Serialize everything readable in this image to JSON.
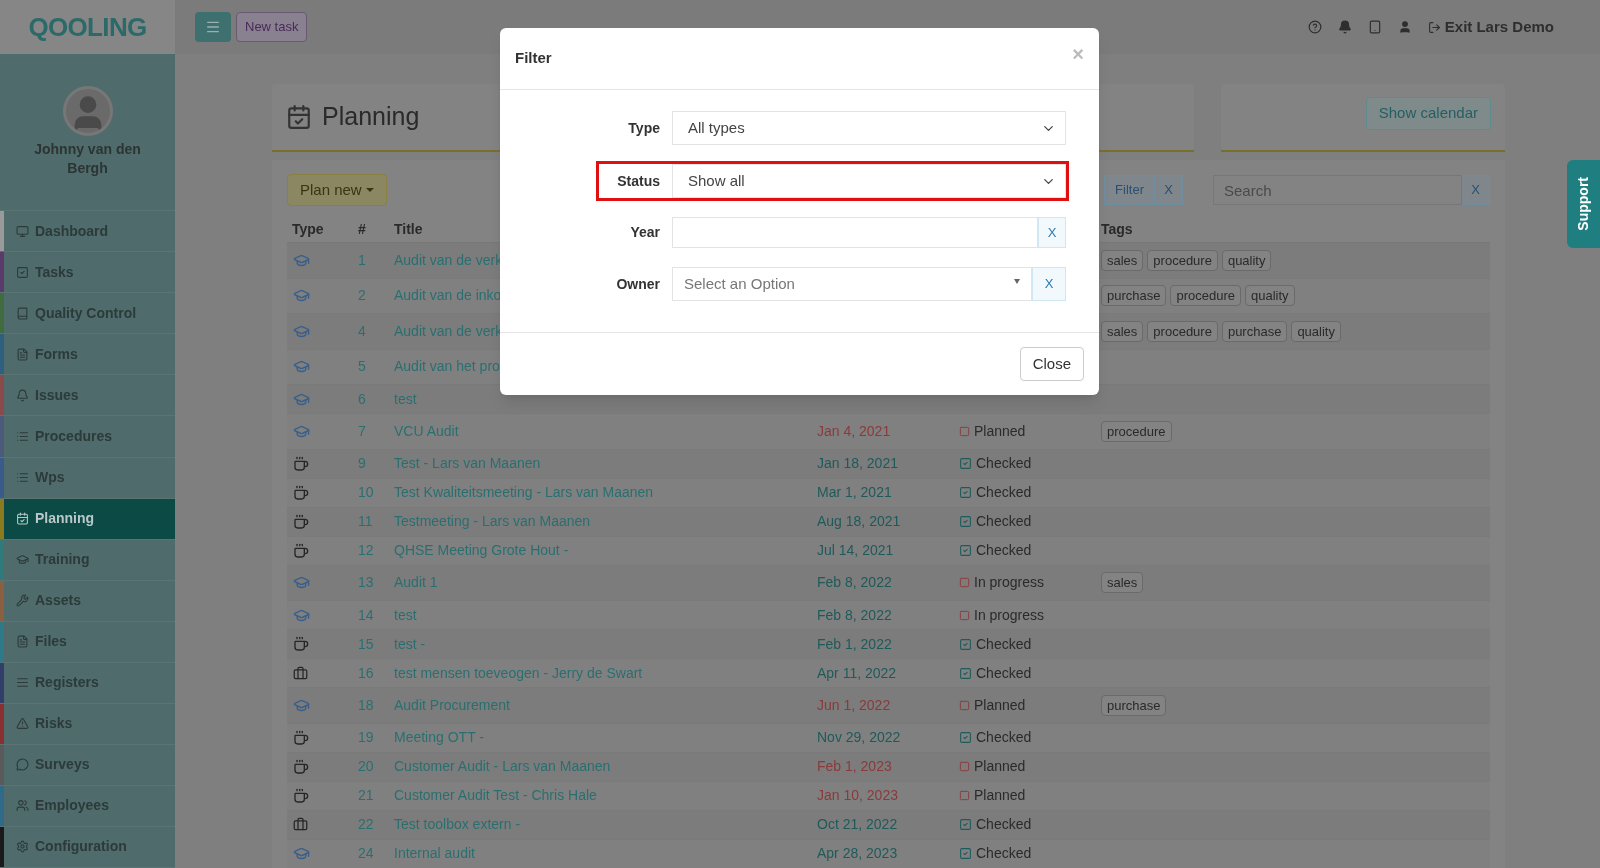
{
  "logo": "QOOLING",
  "header": {
    "new_task": "New task",
    "exit": "Exit Lars Demo"
  },
  "user": {
    "name": "Johnny van den Bergh"
  },
  "sidebar": {
    "items": [
      {
        "label": "Dashboard",
        "kind": "monitor",
        "color": "#9a9a9a",
        "selected": false
      },
      {
        "label": "Tasks",
        "kind": "check",
        "color": "#5a3a6a",
        "selected": false
      },
      {
        "label": "Quality Control",
        "kind": "book",
        "color": "#3f6b3f",
        "selected": false
      },
      {
        "label": "Forms",
        "kind": "file",
        "color": "#2f5f7f",
        "selected": false
      },
      {
        "label": "Issues",
        "kind": "bell",
        "color": "#8a4a4a",
        "selected": false
      },
      {
        "label": "Procedures",
        "kind": "list",
        "color": "#4a5a7a",
        "selected": false
      },
      {
        "label": "Wps",
        "kind": "list",
        "color": "#3a5a8a",
        "selected": false
      },
      {
        "label": "Planning",
        "kind": "calendar",
        "color": "#8a7a20",
        "selected": true
      },
      {
        "label": "Training",
        "kind": "cap",
        "color": "#2f7a7a",
        "selected": false
      },
      {
        "label": "Assets",
        "kind": "wrench",
        "color": "#8a6040",
        "selected": false
      },
      {
        "label": "Files",
        "kind": "file",
        "color": "#2f7a8a",
        "selected": false
      },
      {
        "label": "Registers",
        "kind": "lines",
        "color": "#2f3f6a",
        "selected": false
      },
      {
        "label": "Risks",
        "kind": "warning",
        "color": "#8a2f2f",
        "selected": false
      },
      {
        "label": "Surveys",
        "kind": "chat",
        "color": "#5a5a5a",
        "selected": false
      },
      {
        "label": "Employees",
        "kind": "users",
        "color": "#2f6a8a",
        "selected": false
      },
      {
        "label": "Configuration",
        "kind": "gear",
        "color": "#1a1a1a",
        "selected": false
      }
    ]
  },
  "page": {
    "title": "Planning",
    "show_calendar": "Show calendar",
    "plan_new": "Plan new",
    "filter": "Filter",
    "filter_clear": "X",
    "search": {
      "placeholder": "Search"
    },
    "search_clear": "X"
  },
  "table": {
    "columns": [
      "Type",
      "#",
      "Title",
      "Tags"
    ],
    "rows": [
      {
        "kind": "training",
        "number": "1",
        "title": "Audit van de verk",
        "tags": [
          "sales",
          "procedure",
          "quality"
        ]
      },
      {
        "kind": "training",
        "number": "2",
        "title": "Audit van de inko",
        "tags": [
          "purchase",
          "procedure",
          "quality"
        ]
      },
      {
        "kind": "training",
        "number": "4",
        "title": "Audit van de verk",
        "tags": [
          "sales",
          "procedure",
          "purchase",
          "quality"
        ]
      },
      {
        "kind": "training",
        "number": "5",
        "title": "Audit van het pro",
        "tags": []
      },
      {
        "kind": "training",
        "number": "6",
        "title": "test",
        "tags": []
      },
      {
        "kind": "training",
        "number": "7",
        "title": "VCU Audit",
        "date": "Jan 4, 2021",
        "overdue": true,
        "status": "Planned",
        "checked": false,
        "tags": [
          "procedure"
        ]
      },
      {
        "kind": "meeting",
        "number": "9",
        "title": "Test - Lars van Maanen",
        "date": "Jan 18, 2021",
        "overdue": false,
        "status": "Checked",
        "checked": true,
        "tags": []
      },
      {
        "kind": "meeting",
        "number": "10",
        "title": "Test Kwaliteitsmeeting - Lars van Maanen",
        "date": "Mar 1, 2021",
        "overdue": false,
        "status": "Checked",
        "checked": true,
        "tags": []
      },
      {
        "kind": "meeting",
        "number": "11",
        "title": "Testmeeting - Lars van Maanen",
        "date": "Aug 18, 2021",
        "overdue": false,
        "status": "Checked",
        "checked": true,
        "tags": []
      },
      {
        "kind": "meeting",
        "number": "12",
        "title": "QHSE Meeting Grote Hout -",
        "date": "Jul 14, 2021",
        "overdue": false,
        "status": "Checked",
        "checked": true,
        "tags": []
      },
      {
        "kind": "training",
        "number": "13",
        "title": "Audit 1",
        "date": "Feb 8, 2022",
        "overdue": false,
        "status": "In progress",
        "checked": false,
        "tags": [
          "sales"
        ]
      },
      {
        "kind": "training",
        "number": "14",
        "title": "test",
        "date": "Feb 8, 2022",
        "overdue": false,
        "status": "In progress",
        "checked": false,
        "tags": []
      },
      {
        "kind": "meeting",
        "number": "15",
        "title": "test -",
        "date": "Feb 1, 2022",
        "overdue": false,
        "status": "Checked",
        "checked": true,
        "tags": []
      },
      {
        "kind": "toolbox",
        "number": "16",
        "title": "test mensen toeveogen - Jerry de Swart",
        "date": "Apr 11, 2022",
        "overdue": false,
        "status": "Checked",
        "checked": true,
        "tags": []
      },
      {
        "kind": "training",
        "number": "18",
        "title": "Audit Procurement",
        "date": "Jun 1, 2022",
        "overdue": true,
        "status": "Planned",
        "checked": false,
        "tags": [
          "purchase"
        ]
      },
      {
        "kind": "meeting",
        "number": "19",
        "title": "Meeting OTT -",
        "date": "Nov 29, 2022",
        "overdue": false,
        "status": "Checked",
        "checked": true,
        "tags": []
      },
      {
        "kind": "meeting",
        "number": "20",
        "title": "Customer Audit - Lars van Maanen",
        "date": "Feb 1, 2023",
        "overdue": true,
        "status": "Planned",
        "checked": false,
        "tags": []
      },
      {
        "kind": "meeting",
        "number": "21",
        "title": "Customer Audit Test - Chris Hale",
        "date": "Jan 10, 2023",
        "overdue": true,
        "status": "Planned",
        "checked": false,
        "tags": []
      },
      {
        "kind": "toolbox",
        "number": "22",
        "title": "Test toolbox extern -",
        "date": "Oct 21, 2022",
        "overdue": false,
        "status": "Checked",
        "checked": true,
        "tags": []
      },
      {
        "kind": "training",
        "number": "24",
        "title": "Internal audit",
        "date": "Apr 28, 2023",
        "overdue": false,
        "status": "Checked",
        "checked": true,
        "tags": []
      }
    ]
  },
  "support": "Support",
  "dialog": {
    "title": "Filter",
    "close_x": "×",
    "fields": [
      {
        "label": "Type",
        "kind": "select",
        "value": "All types",
        "highlighted": false
      },
      {
        "label": "Status",
        "kind": "select",
        "value": "Show all",
        "highlighted": true
      },
      {
        "label": "Year",
        "kind": "text",
        "clear": "X",
        "highlighted": false
      },
      {
        "label": "Owner",
        "kind": "combo",
        "placeholder": "Select an Option",
        "clear": "X",
        "highlighted": false
      }
    ],
    "close": "Close"
  }
}
